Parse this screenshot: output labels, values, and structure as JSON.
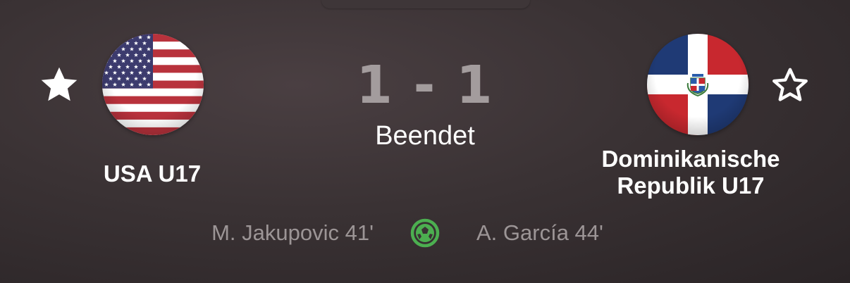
{
  "match": {
    "score": "1 - 1",
    "status": "Beendet"
  },
  "home_team": {
    "name": "USA U17",
    "flag_icon": "usa-flag-icon",
    "favorite_icon": "star-filled-icon"
  },
  "away_team": {
    "name": "Dominikanische\nRepublik U17",
    "flag_icon": "dominican-republic-flag-icon",
    "favorite_icon": "star-outline-icon"
  },
  "goals": {
    "home_scorer": "M. Jakupovic 41'",
    "away_scorer": "A. García 44'",
    "icon": "soccer-ball-icon"
  },
  "colors": {
    "background": "#3a3234",
    "score": "#a39c9d",
    "scorer_text": "#9c9596",
    "goal_icon": "#4caf50"
  }
}
